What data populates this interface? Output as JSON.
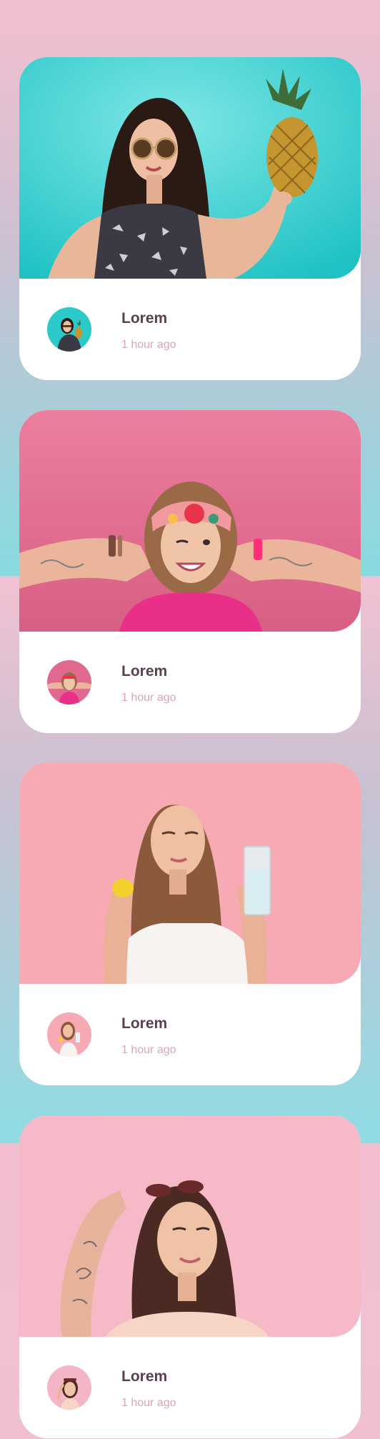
{
  "cards": [
    {
      "name": "Lorem",
      "time": "1 hour ago",
      "photo_theme": "teal",
      "bg_color": "#2cc9c9",
      "avatar_icon": "woman-pineapple-avatar"
    },
    {
      "name": "Lorem",
      "time": "1 hour ago",
      "photo_theme": "pink",
      "bg_color": "#e06a8e",
      "avatar_icon": "woman-headband-avatar"
    },
    {
      "name": "Lorem",
      "time": "1 hour ago",
      "photo_theme": "light-pink",
      "bg_color": "#f6a9b3",
      "avatar_icon": "woman-lemon-avatar"
    },
    {
      "name": "Lorem",
      "time": "1 hour ago",
      "photo_theme": "pale-pink",
      "bg_color": "#f4b6c6",
      "avatar_icon": "woman-sunglasses-avatar"
    }
  ],
  "colors": {
    "name_text": "#5a4050",
    "time_text": "#d7a6b6",
    "card_bg": "#ffffff"
  }
}
